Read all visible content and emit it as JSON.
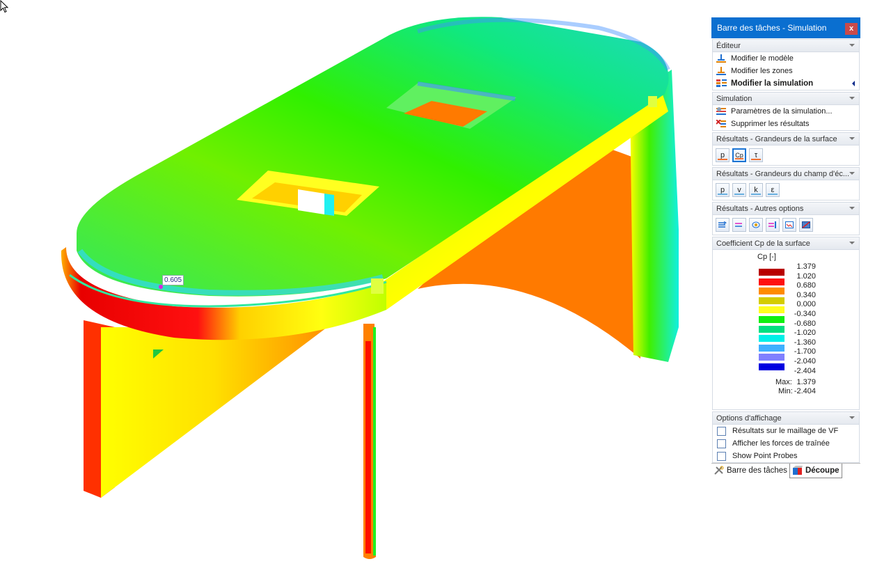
{
  "panel": {
    "title": "Barre des tâches - Simulation",
    "close_label": "x",
    "sections": {
      "editor": {
        "header": "Éditeur",
        "items": [
          {
            "label": "Modifier le modèle",
            "icon": "model-edit-icon"
          },
          {
            "label": "Modifier les zones",
            "icon": "zones-edit-icon"
          },
          {
            "label": "Modifier la simulation",
            "icon": "simulation-edit-icon",
            "active": true
          }
        ]
      },
      "simulation": {
        "header": "Simulation",
        "items": [
          {
            "label": "Paramètres de la simulation...",
            "icon": "simulation-settings-icon"
          },
          {
            "label": "Supprimer les résultats",
            "icon": "delete-results-icon"
          }
        ]
      },
      "surface_results": {
        "header": "Résultats - Grandeurs de la surface",
        "buttons": [
          {
            "label": "p",
            "name": "pressure"
          },
          {
            "label": "Cp",
            "name": "pressure-coefficient",
            "selected": true
          },
          {
            "label": "τ",
            "name": "shear-stress"
          }
        ]
      },
      "field_results": {
        "header": "Résultats - Grandeurs du champ d'éc...",
        "buttons": [
          {
            "label": "p",
            "name": "pressure"
          },
          {
            "label": "v",
            "name": "velocity"
          },
          {
            "label": "k",
            "name": "turbulent-kinetic-energy"
          },
          {
            "label": "ε",
            "name": "dissipation-rate"
          }
        ]
      },
      "other_options": {
        "header": "Résultats - Autres options",
        "buttons": [
          {
            "name": "streamlines",
            "icon": "streamlines-icon"
          },
          {
            "name": "arrows",
            "icon": "arrows-icon"
          },
          {
            "name": "iso-surfaces",
            "icon": "iso-surfaces-icon"
          },
          {
            "name": "vectors-plane",
            "icon": "vectors-plane-icon"
          },
          {
            "name": "diagram",
            "icon": "diagram-icon"
          },
          {
            "name": "clipping",
            "icon": "clipping-icon"
          }
        ]
      },
      "legend": {
        "header": "Coefficient Cp de la surface",
        "title": "Cp [-]",
        "values": [
          "1.379",
          "1.020",
          "0.680",
          "0.340",
          "0.000",
          "-0.340",
          "-0.680",
          "-1.020",
          "-1.360",
          "-1.700",
          "-2.040",
          "-2.404"
        ],
        "colors": [
          "#b80000",
          "#ff1010",
          "#ff8c00",
          "#d4cc00",
          "#ffff20",
          "#10f010",
          "#00e080",
          "#00f0e8",
          "#40b0ff",
          "#8080ff",
          "#0000e0"
        ],
        "max_label": "Max:",
        "max_value": "1.379",
        "min_label": "Min:",
        "min_value": "-2.404"
      },
      "display_options": {
        "header": "Options d'affichage",
        "checkboxes": [
          {
            "label": "Résultats sur le maillage de VF",
            "checked": false
          },
          {
            "label": "Afficher les forces de traînée",
            "checked": false
          },
          {
            "label": "Show Point Probes",
            "checked": false
          }
        ]
      }
    },
    "tabs": [
      {
        "label": "Barre des tâches",
        "icon": "tools-icon",
        "active": false
      },
      {
        "label": "Découpe",
        "icon": "clipping-box-icon",
        "active": true
      }
    ]
  },
  "viewport": {
    "probe_value": "0.605"
  }
}
